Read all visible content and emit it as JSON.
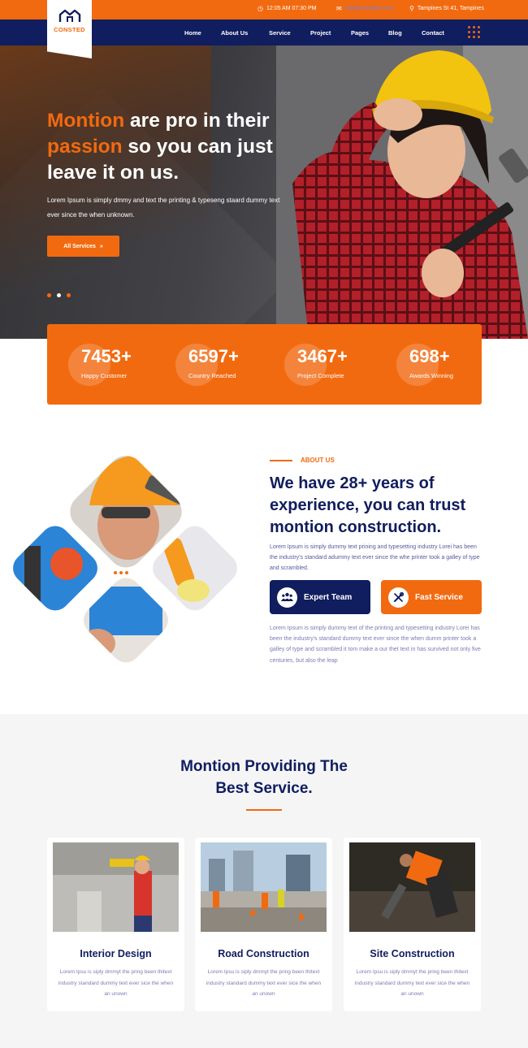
{
  "topbar": {
    "hours": "12:05 AM 07:30 PM",
    "email": "info@example.com",
    "address": "Tampines St 41, Tampines"
  },
  "logo": {
    "text": "CONSTED"
  },
  "nav": [
    "Home",
    "About Us",
    "Service",
    "Project",
    "Pages",
    "Blog",
    "Contact"
  ],
  "hero": {
    "title_hl1": "Montion",
    "title_p1": " are pro in their",
    "title_hl2": "passion",
    "title_p2": " so you can just leave it on us.",
    "text": "Lorem Ipsum is simply dmmy and text the printing & typeseng staard dummy text ever since the when unknown.",
    "button": "All Services",
    "button_icon": "»"
  },
  "stats": [
    {
      "num": "7453+",
      "label": "Happy Customer"
    },
    {
      "num": "6597+",
      "label": "Country Reached"
    },
    {
      "num": "3467+",
      "label": "Project Complete"
    },
    {
      "num": "698+",
      "label": "Awards Winning"
    }
  ],
  "about": {
    "tag": "ABOUT US",
    "title": "We have 28+ years of experience, you can trust montion construction.",
    "lead": "Lorem Ipsum is simply dummy text prining and typesetting industry Lorei has been the industry's standard adummy text ever since the whe printer took a galley of type and scrambled.",
    "badge1": "Expert Team",
    "badge2": "Fast Service",
    "text": "Lorem Ipsum is simply dummy text of the printing and typesetting industry Lorei has been the industry's standard dummy text ever since the when dumm printer took a galley of type and scrambled it tom make a our thet text in has survived not only five centuries, but also the leap"
  },
  "services": {
    "title1": "Montion Providing The",
    "title2": "Best Service.",
    "cards": [
      {
        "title": "Interior Design",
        "desc": "Lorem Ipsu is siply dmmyt the pring been thitext industry standard dummy text ever sice the when an unown"
      },
      {
        "title": "Road Construction",
        "desc": "Lorem Ipsu is siply dmmyt the pring been thitext industry standard dummy text ever sice the when an unown"
      },
      {
        "title": "Site Construction",
        "desc": "Lorem Ipsu is siply dmmyt the pring been thitext industry standard dummy text ever sice the when an unown"
      }
    ]
  },
  "colors": {
    "accent": "#f26a10",
    "navy": "#101d5e"
  }
}
